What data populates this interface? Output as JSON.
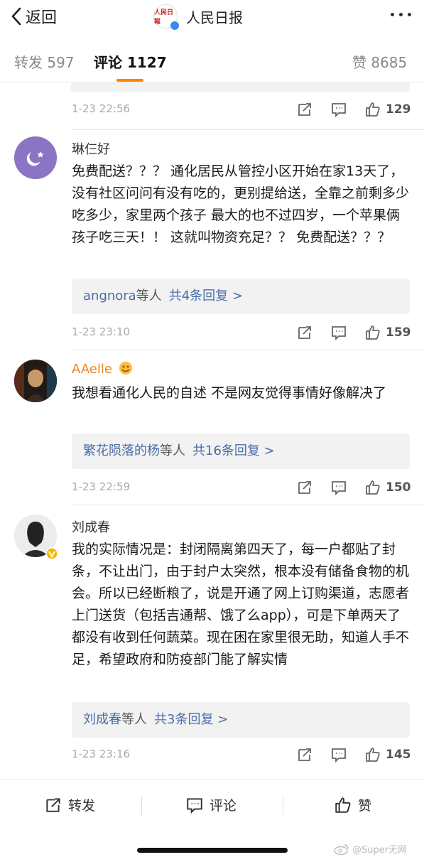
{
  "nav": {
    "back_label": "返回",
    "account_name": "人民日报",
    "logo_text": "人民日報"
  },
  "tabs": {
    "repost": "转发 597",
    "comment": "评论 1127",
    "like": "赞 8685"
  },
  "comments": [
    {
      "time": "1-23 22:56",
      "likes": "129"
    },
    {
      "user": "琳仨好",
      "text": "免费配送？？？ 通化居民从管控小区开始在家13天了，没有社区问问有没有吃的，更别提给送，全靠之前剩多少吃多少，家里两个孩子 最大的也不过四岁，一个苹果俩孩子吃三天！！ 这就叫物资充足？？ 免费配送？？？",
      "reply_user": "angnora",
      "reply_suffix": "等人",
      "reply_count": "共4条回复 >",
      "time": "1-23 23:10",
      "likes": "159"
    },
    {
      "user": "AAelle",
      "text": "我想看通化人民的自述 不是网友觉得事情好像解决了",
      "reply_user": "繁花陨落的杨",
      "reply_suffix": "等人",
      "reply_count": "共16条回复 >",
      "time": "1-23 22:59",
      "likes": "150"
    },
    {
      "user": "刘成春",
      "text": "我的实际情况是：封闭隔离第四天了，每一户都贴了封条，不让出门，由于封户太突然，根本没有储备食物的机会。所以已经断粮了，说是开通了网上订购渠道，志愿者上门送货（包括吉通帮、饿了么app），可是下单两天了都没有收到任何蔬菜。现在困在家里很无助，知道人手不足，希望政府和防疫部门能了解实情",
      "reply_user": "刘成春",
      "reply_suffix": "等人",
      "reply_count": "共3条回复 >",
      "time": "1-23 23:16",
      "likes": "145"
    }
  ],
  "bottom": {
    "repost": "转发",
    "comment": "评论",
    "like": "赞"
  },
  "watermark": "@Super无网",
  "colors": {
    "accent": "#ff8200",
    "link": "#4a6da8",
    "gold_name": "#e8872a"
  }
}
